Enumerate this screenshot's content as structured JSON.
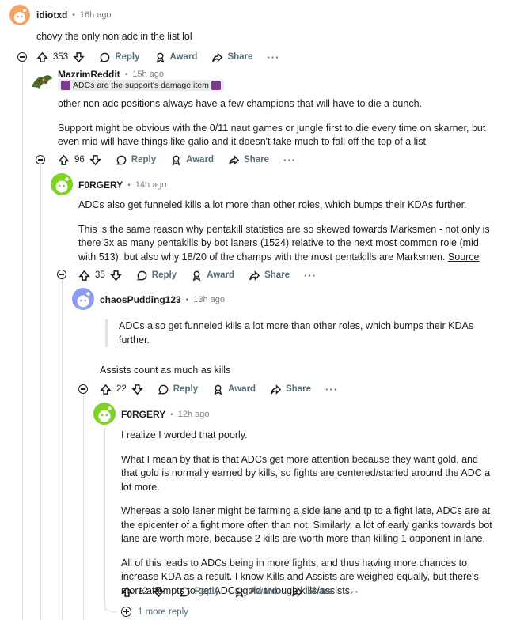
{
  "comments": [
    {
      "username": "idiotxd",
      "time": "16h ago",
      "paragraphs": [
        "chovy the only non adc in the list lol"
      ],
      "score": "353"
    },
    {
      "username": "MazrimReddit",
      "time": "15h ago",
      "flair": "ADCs are the support's damage item",
      "paragraphs": [
        "other non adc positions always have a few champions that will have to die a bunch.",
        "Support might be obvious with the 0/11 naut games or jungle first to die every time on skarner, but even mid will have things like galio and it doesn't take much to fall off the top of a list"
      ],
      "score": "96"
    },
    {
      "username": "F0RGERY",
      "time": "14h ago",
      "paragraphs": [
        "ADCs also get funneled kills a lot more than other roles, which bumps their KDAs further.",
        "This is the same reason why pentakill statistics are so skewed towards Marksmen - not only is there 3x as many pentakills by bot laners (1524) relative to the next most common role (mid with 513), but also why 18/20 of the champs with the most pentakills are Marksmen."
      ],
      "link": "Source",
      "score": "35"
    },
    {
      "username": "chaosPudding123",
      "time": "13h ago",
      "quote": "ADCs also get funneled kills a lot more than other roles, which bumps their KDAs further.",
      "paragraphs": [
        "Assists count as much as kills"
      ],
      "score": "22"
    },
    {
      "username": "F0RGERY",
      "time": "12h ago",
      "paragraphs": [
        "I realize I worded that poorly.",
        "What I mean by that is that ADCs get more attention because they want gold, and that gold is normally earned by kills, so fights are centered/started around the ADC a lot more.",
        "Whereas a solo laner might be farming a side lane and tp to a fight late, ADCs are at the epicenter of a fight more often than not. Similarly, a lot of early ganks towards bot lane are worth more, because 2 kills are worth more than killing 1 opponent in lane.",
        "All of this leads to ADCs being in more fights, and thus having more chances to increase KDA as a result. I know Kills and Assists are weighed equally, but there's more attempts to get ADCs gold through kills/assists."
      ],
      "score": "12"
    }
  ],
  "actions": {
    "reply": "Reply",
    "award": "Award",
    "share": "Share",
    "more": "···"
  },
  "more_replies": "1 more reply",
  "colors": {
    "avatar_orange": "#f5a263",
    "avatar_green": "#7ed321",
    "avatar_blue": "#8a9df0",
    "thread_line": "#dfe3e6"
  }
}
